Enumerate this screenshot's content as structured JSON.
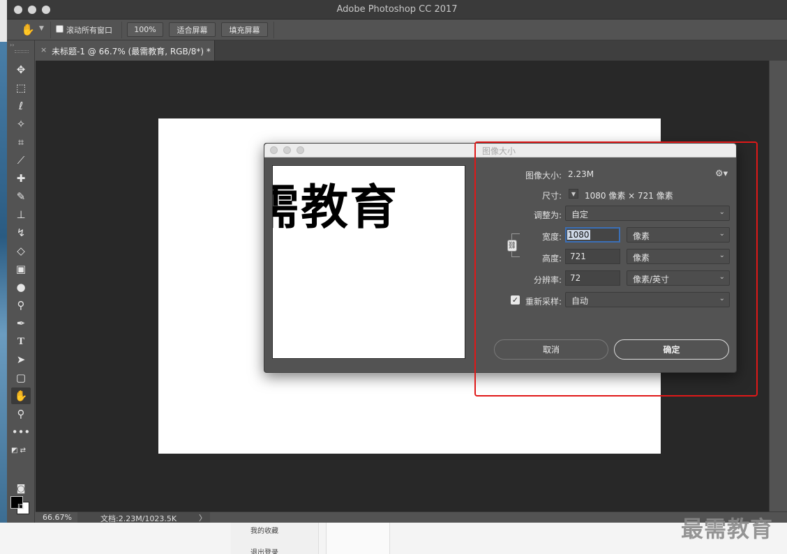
{
  "app": {
    "title": "Adobe Photoshop CC 2017"
  },
  "options_bar": {
    "scroll_all_label": "滚动所有窗口",
    "zoom_100": "100%",
    "fit_screen": "适合屏幕",
    "fill_screen": "填充屏幕"
  },
  "document_tab": {
    "title": "未标题-1 @ 66.7% (最需教育, RGB/8*) *",
    "close": "×"
  },
  "status_bar": {
    "zoom": "66.67%",
    "doc_info": "文档:2.23M/1023.5K",
    "arrow": "〉"
  },
  "dialog": {
    "title": "图像大小",
    "preview_text": "需教育",
    "image_size_label": "图像大小:",
    "image_size_value": "2.23M",
    "dimensions_label": "尺寸:",
    "dimensions_value": "1080 像素  ×  721 像素",
    "fit_to_label": "调整为:",
    "fit_to_value": "自定",
    "width_label": "宽度:",
    "width_value": "1080",
    "width_unit": "像素",
    "height_label": "高度:",
    "height_value": "721",
    "height_unit": "像素",
    "resolution_label": "分辨率:",
    "resolution_value": "72",
    "resolution_unit": "像素/英寸",
    "resample_label": "重新采样:",
    "resample_value": "自动",
    "cancel": "取消",
    "ok": "确定"
  },
  "web_page": {
    "link1": "我的收藏",
    "link2": "退出登录"
  },
  "watermark": "最需教育",
  "colors": {
    "highlight": "#e01818",
    "focus": "#3b6fb6"
  }
}
